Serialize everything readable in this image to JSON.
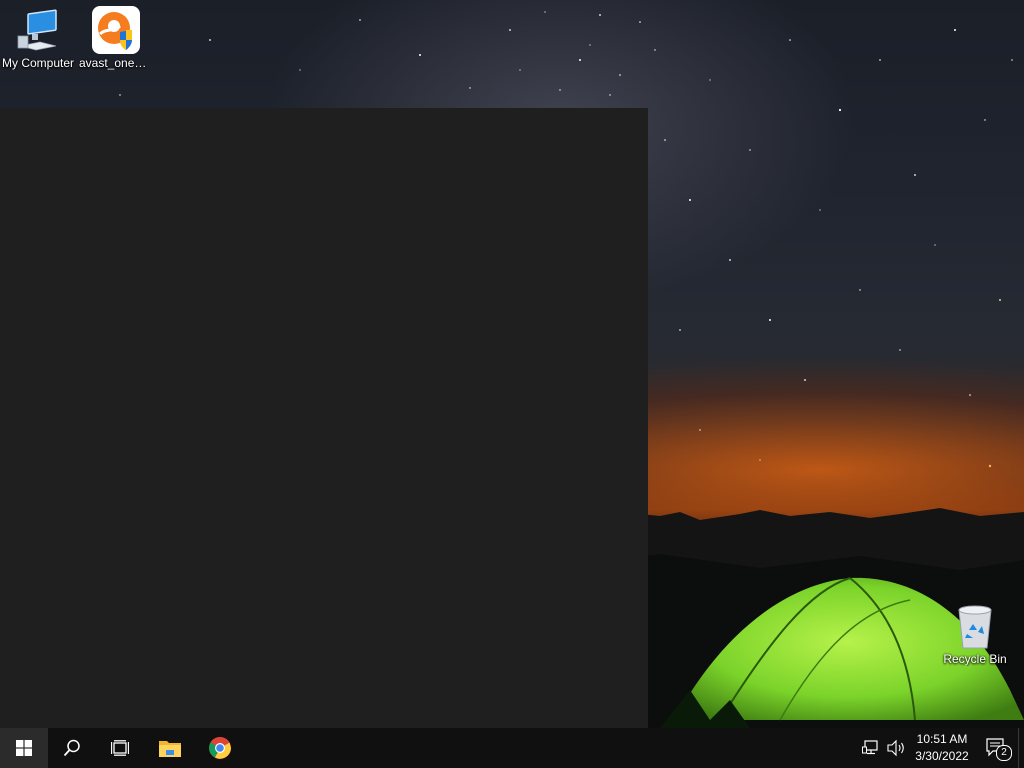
{
  "desktop": {
    "icons": [
      {
        "label": "My Computer",
        "icon": "computer-icon"
      },
      {
        "label": "avast_one_e...",
        "icon": "avast-icon"
      },
      {
        "label": "Recycle Bin",
        "icon": "recycle-bin-icon"
      }
    ]
  },
  "taskbar": {
    "buttons": [
      {
        "name": "start",
        "icon": "windows-logo-icon"
      },
      {
        "name": "search",
        "icon": "search-icon"
      },
      {
        "name": "task-view",
        "icon": "task-view-icon"
      },
      {
        "name": "file-explorer",
        "icon": "folder-icon"
      },
      {
        "name": "chrome",
        "icon": "chrome-icon"
      }
    ],
    "tray": {
      "network_icon": "network-icon",
      "volume_icon": "volume-icon",
      "time": "10:51 AM",
      "date": "3/30/2022",
      "notification_count": "2"
    }
  },
  "colors": {
    "window_bg": "#1f1f1f",
    "taskbar_bg": "#101010",
    "tent_green": "#7bd32a"
  }
}
